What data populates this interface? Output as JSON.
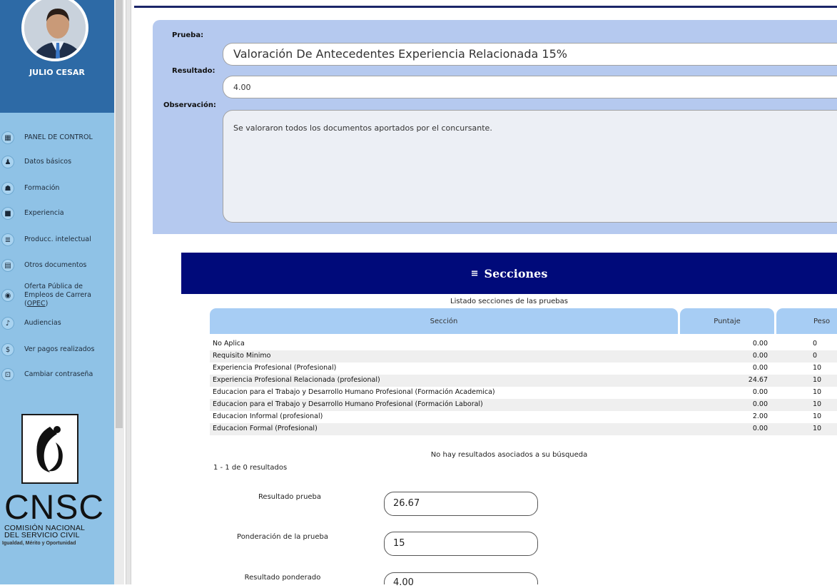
{
  "sidebar": {
    "user_name": "JULIO CESAR",
    "items": [
      {
        "label": "PANEL DE CONTROL",
        "icon": "dashboard-icon"
      },
      {
        "label": "Datos básicos",
        "icon": "people-icon"
      },
      {
        "label": "Formación",
        "icon": "reading-icon"
      },
      {
        "label": "Experiencia",
        "icon": "briefcase-icon"
      },
      {
        "label": "Producc. intelectual",
        "icon": "document-icon"
      },
      {
        "label": "Otros documentos",
        "icon": "file-icon"
      },
      {
        "label_line1": "Oferta Pública de",
        "label_line2": "Empleos de Carrera (",
        "label_opec": "OPEC",
        "label_close": ")",
        "icon": "globe-icon"
      },
      {
        "label": "Audiencias",
        "icon": "speaker-icon"
      },
      {
        "label": "Ver pagos realizados",
        "icon": "dollar-icon"
      },
      {
        "label": "Cambiar contraseña",
        "icon": "lock-icon"
      }
    ],
    "logo": {
      "text": "CNSC",
      "sub1": "COMISIÓN NACIONAL",
      "sub2": "DEL SERVICIO CIVIL",
      "tagline": "Igualdad, Mérito y Oportunidad"
    }
  },
  "form": {
    "prueba_label": "Prueba:",
    "prueba_value": "Valoración De Antecedentes Experiencia Relacionada 15%",
    "resultado_label": "Resultado:",
    "resultado_value": "4.00",
    "observacion_label": "Observación:",
    "observacion_value": "Se valoraron todos los documentos aportados por el concursante."
  },
  "secciones": {
    "title": "Secciones",
    "caption": "Listado secciones de las pruebas",
    "columns": [
      "Sección",
      "Puntaje",
      "Peso"
    ],
    "rows": [
      {
        "seccion": "No Aplica",
        "puntaje": "0.00",
        "peso": "0"
      },
      {
        "seccion": "Requisito Minimo",
        "puntaje": "0.00",
        "peso": "0"
      },
      {
        "seccion": "Experiencia Profesional (Profesional)",
        "puntaje": "0.00",
        "peso": "10"
      },
      {
        "seccion": "Experiencia Profesional Relacionada (profesional)",
        "puntaje": "24.67",
        "peso": "10"
      },
      {
        "seccion": "Educacion para el Trabajo y Desarrollo Humano Profesional (Formación Academica)",
        "puntaje": "0.00",
        "peso": "10"
      },
      {
        "seccion": "Educacion para el Trabajo y Desarrollo Humano Profesional (Formación Laboral)",
        "puntaje": "0.00",
        "peso": "10"
      },
      {
        "seccion": "Educacion Informal (profesional)",
        "puntaje": "2.00",
        "peso": "10"
      },
      {
        "seccion": "Educacion Formal (Profesional)",
        "puntaje": "0.00",
        "peso": "10"
      }
    ],
    "no_results": "No hay resultados asociados a su búsqueda",
    "count": "1 - 1 de 0 resultados"
  },
  "results": {
    "resultado_prueba_label": "Resultado prueba",
    "resultado_prueba_value": "26.67",
    "ponderacion_label": "Ponderación de la prueba",
    "ponderacion_value": "15",
    "resultado_ponderado_label": "Resultado ponderado",
    "resultado_ponderado_value": "4.00"
  },
  "colors": {
    "sidebar": "#8fc2e6",
    "profile": "#2d6aa6",
    "panel": "#b5c9ef",
    "header": "#000a7a",
    "table_header": "#a7cdf4"
  }
}
